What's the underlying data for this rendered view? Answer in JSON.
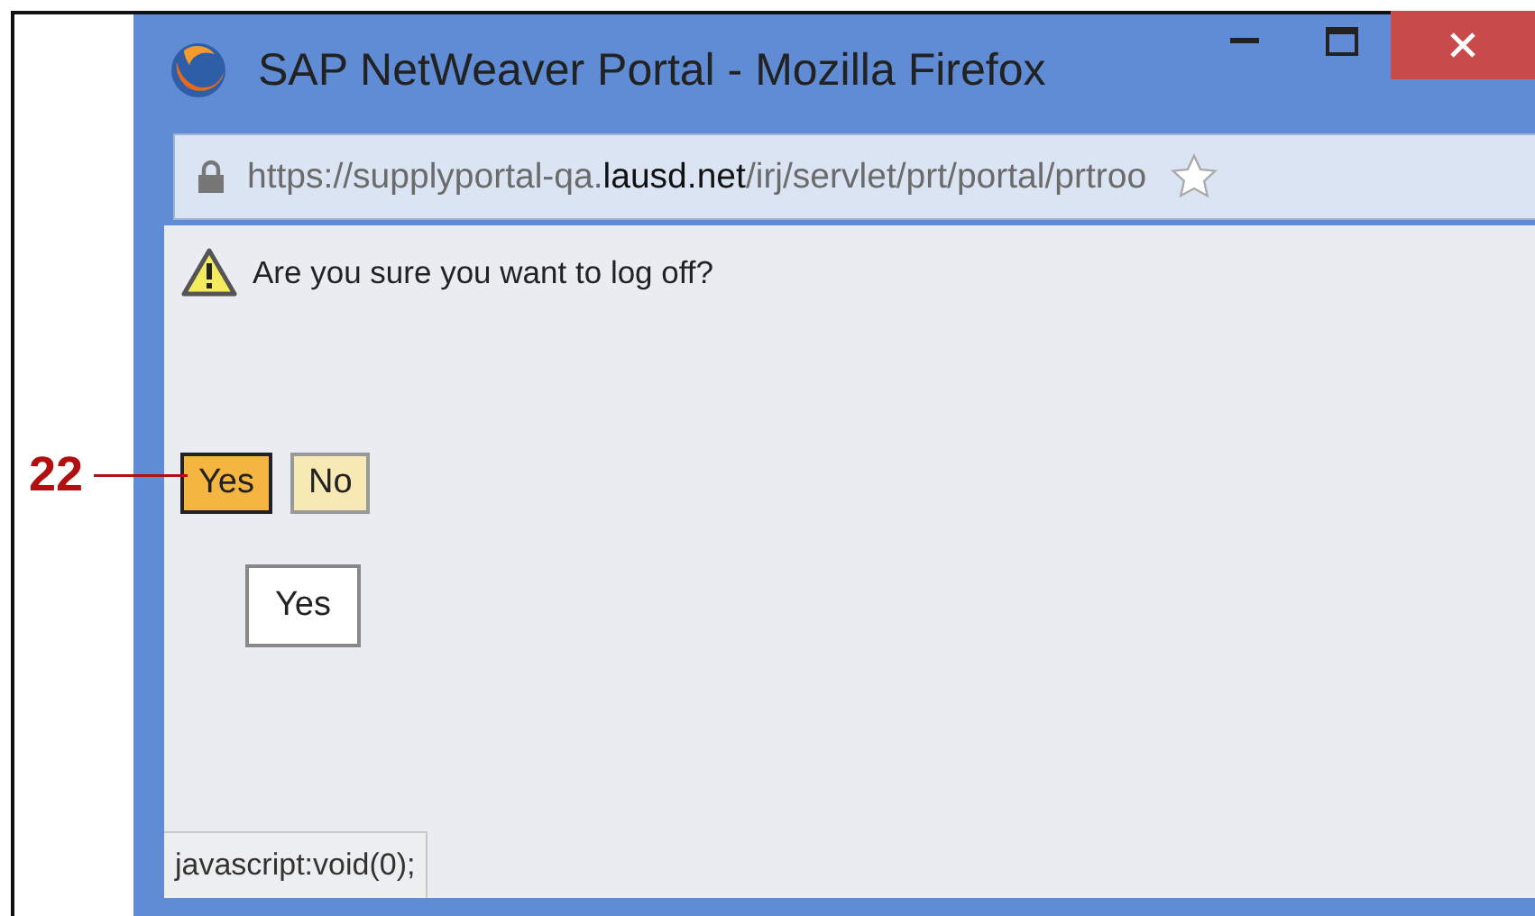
{
  "window": {
    "title": "SAP NetWeaver Portal - Mozilla Firefox"
  },
  "address_bar": {
    "scheme_part": "https://supplyportal-qa.",
    "domain": "lausd.net",
    "path": "/irj/servlet/prt/portal/prtroo"
  },
  "dialog": {
    "message": "Are you sure you want to log off?",
    "buttons": [
      {
        "label": "Yes",
        "selected": true
      },
      {
        "label": "No",
        "selected": false
      }
    ],
    "tooltip": "Yes"
  },
  "status_bar": {
    "text": "javascript:void(0);"
  },
  "callout": {
    "number": "22"
  }
}
